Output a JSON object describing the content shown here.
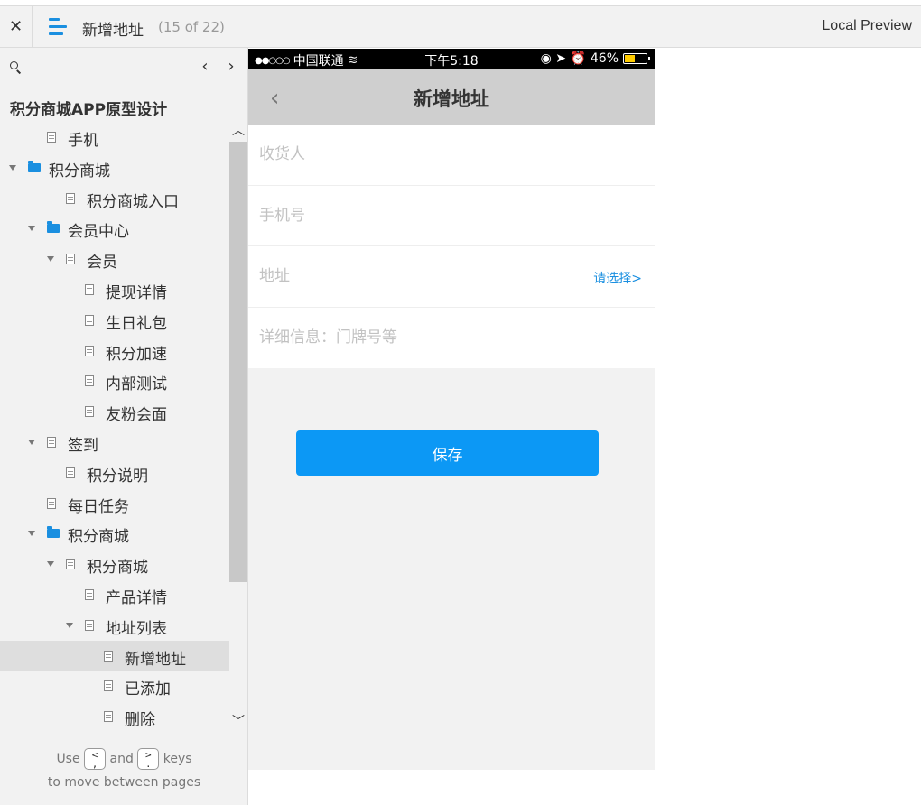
{
  "topbar": {
    "close_glyph": "✕",
    "title": "新增地址",
    "page_count": "(15 of 22)",
    "local_preview": "Local Preview"
  },
  "sidebar": {
    "nav_prev": "‹",
    "nav_next": "›",
    "project_title": "积分商城APP原型设计",
    "tree": [
      {
        "label": "手机",
        "type": "page",
        "expanded": false,
        "selected": false
      },
      {
        "label": "积分商城",
        "type": "folder",
        "expanded": true,
        "selected": false
      },
      {
        "label": "积分商城入口",
        "type": "page",
        "expanded": false,
        "selected": false
      },
      {
        "label": "会员中心",
        "type": "folder",
        "expanded": true,
        "selected": false
      },
      {
        "label": "会员",
        "type": "page",
        "expanded": true,
        "selected": false
      },
      {
        "label": "提现详情",
        "type": "page",
        "expanded": false,
        "selected": false
      },
      {
        "label": "生日礼包",
        "type": "page",
        "expanded": false,
        "selected": false
      },
      {
        "label": "积分加速",
        "type": "page",
        "expanded": false,
        "selected": false
      },
      {
        "label": "内部测试",
        "type": "page",
        "expanded": false,
        "selected": false
      },
      {
        "label": "友粉会面",
        "type": "page",
        "expanded": false,
        "selected": false
      },
      {
        "label": "签到",
        "type": "page",
        "expanded": true,
        "selected": false
      },
      {
        "label": "积分说明",
        "type": "page",
        "expanded": false,
        "selected": false
      },
      {
        "label": "每日任务",
        "type": "page",
        "expanded": false,
        "selected": false
      },
      {
        "label": "积分商城",
        "type": "folder",
        "expanded": true,
        "selected": false
      },
      {
        "label": "积分商城",
        "type": "page",
        "expanded": true,
        "selected": false
      },
      {
        "label": "产品详情",
        "type": "page",
        "expanded": false,
        "selected": false
      },
      {
        "label": "地址列表",
        "type": "page",
        "expanded": true,
        "selected": false
      },
      {
        "label": "新增地址",
        "type": "page",
        "expanded": false,
        "selected": true
      },
      {
        "label": "已添加",
        "type": "page",
        "expanded": false,
        "selected": false
      },
      {
        "label": "删除",
        "type": "page",
        "expanded": false,
        "selected": false
      }
    ],
    "hint": {
      "use": "Use",
      "prev_key_top": "<",
      "prev_key_bottom": ",",
      "and": "and",
      "next_key_top": ">",
      "next_key_bottom": ".",
      "keys": "keys",
      "line2": "to move between pages"
    }
  },
  "phone": {
    "status": {
      "carrier_dots": "●●○○○",
      "carrier": "中国联通",
      "wifi": "≋",
      "time": "下午5:18",
      "icons": "◉ ➤ ⏰",
      "battery": "46%",
      "battery_level": 0.46
    },
    "nav": {
      "back": "‹",
      "title": "新增地址"
    },
    "form": {
      "recipient_placeholder": "收货人",
      "phone_placeholder": "手机号",
      "address_placeholder": "地址",
      "select_label": "请选择>",
      "detail_placeholder": "详细信息：门牌号等"
    },
    "save_label": "保存"
  },
  "colors": {
    "accent": "#1a8fe0",
    "save_button": "#0c98f5",
    "navbar": "#cfcfcf",
    "sidebar_bg": "#f2f2f2",
    "selected_row": "#dedede",
    "battery_yellow": "#ffcc00"
  }
}
